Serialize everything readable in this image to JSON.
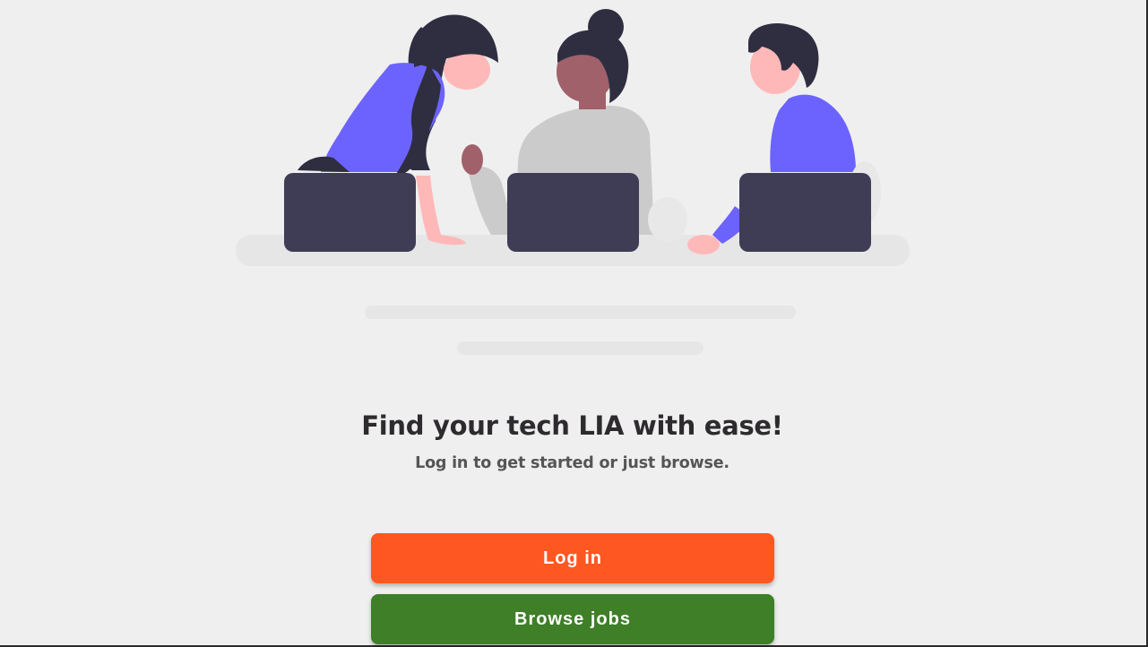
{
  "hero": {
    "illustration": "three-people-working-at-laptops",
    "headline": "Find your tech LIA with ease!",
    "subheadline": "Log in to get started or just browse."
  },
  "actions": {
    "login_label": "Log in",
    "browse_label": "Browse jobs"
  },
  "colors": {
    "background": "#efefef",
    "login_button": "#ff5722",
    "browse_button": "#3e7f28",
    "accent_purple": "#6c63ff",
    "laptop": "#3f3d56",
    "text_dark": "#2d2b2e",
    "text_muted": "#555555"
  }
}
